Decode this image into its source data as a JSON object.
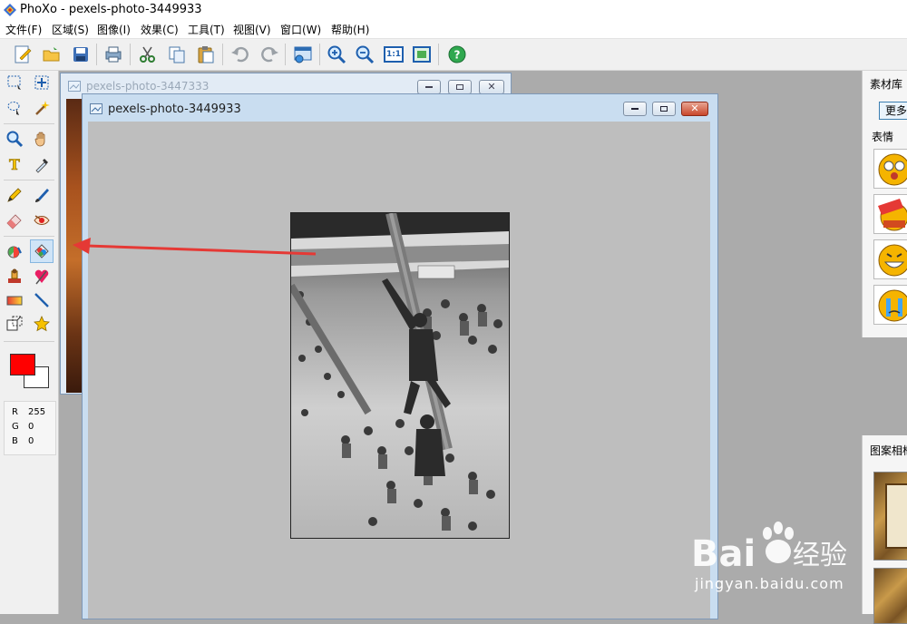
{
  "app": {
    "title": "PhoXo - pexels-photo-3449933"
  },
  "menu": [
    {
      "label": "文件(F)"
    },
    {
      "label": "区域(S)"
    },
    {
      "label": "图像(I)"
    },
    {
      "label": "效果(C)"
    },
    {
      "label": "工具(T)"
    },
    {
      "label": "视图(V)"
    },
    {
      "label": "窗口(W)"
    },
    {
      "label": "帮助(H)"
    }
  ],
  "toolbar": [
    {
      "icon": "new-document-icon"
    },
    {
      "icon": "open-folder-icon"
    },
    {
      "icon": "save-disk-icon"
    },
    {
      "icon": "print-icon"
    },
    {
      "icon": "cut-scissors-icon"
    },
    {
      "icon": "copy-icon"
    },
    {
      "icon": "paste-icon"
    },
    {
      "icon": "undo-icon"
    },
    {
      "icon": "redo-icon"
    },
    {
      "icon": "window-settings-icon"
    },
    {
      "icon": "zoom-in-icon"
    },
    {
      "icon": "zoom-out-icon"
    },
    {
      "icon": "actual-size-icon",
      "label": "1:1"
    },
    {
      "icon": "fit-screen-icon"
    },
    {
      "icon": "help-icon"
    }
  ],
  "tools": {
    "active": "color-replace-tool",
    "colors": {
      "foreground": "#ff0000",
      "background": "#ffffff"
    },
    "rgb": [
      {
        "channel": "R",
        "value": "255"
      },
      {
        "channel": "G",
        "value": "0"
      },
      {
        "channel": "B",
        "value": "0"
      }
    ]
  },
  "windows": {
    "back": {
      "title": "pexels-photo-3447333"
    },
    "front": {
      "title": "pexels-photo-3449933"
    }
  },
  "right_panels": {
    "materials": {
      "title": "素材库",
      "more_button": "更多",
      "section": "表情"
    },
    "frames": {
      "title": "图案相框"
    }
  },
  "watermark": {
    "brand": "Bai",
    "brand_cn": "经验",
    "url": "jingyan.baidu.com"
  },
  "colors": {
    "arrow": "#e53935",
    "workspace": "#ababab",
    "accent": "#3c7fb1"
  }
}
